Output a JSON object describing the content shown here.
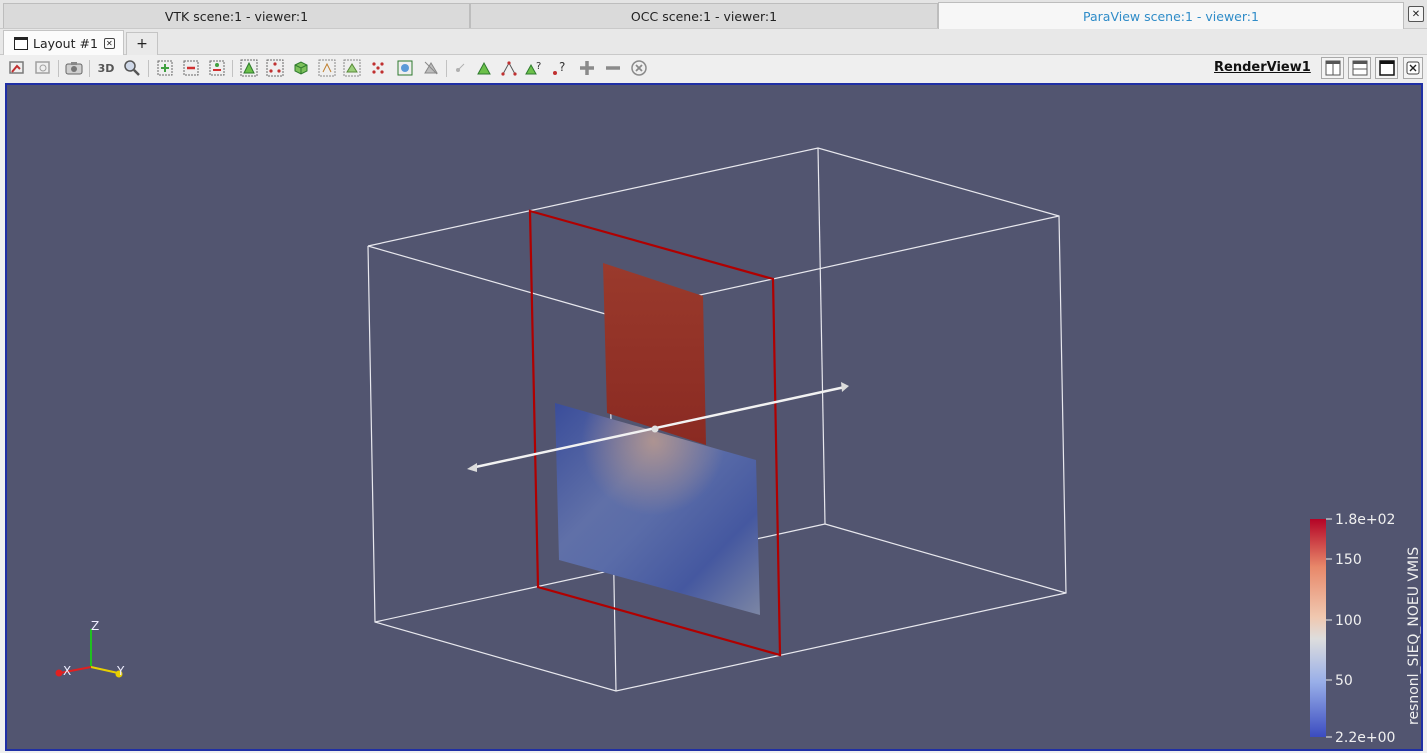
{
  "viewer_tabs": [
    {
      "label": "VTK scene:1 - viewer:1",
      "active": false
    },
    {
      "label": "OCC scene:1 - viewer:1",
      "active": false
    },
    {
      "label": "ParaView scene:1 - viewer:1",
      "active": true
    }
  ],
  "viewer_close_glyph": "✕",
  "layout_tab": {
    "label": "Layout #1",
    "close_glyph": "✕"
  },
  "add_tab_label": "+",
  "toolbar": {
    "three_d_label": "3D",
    "render_view_label": "RenderView1",
    "icons": [
      "reset-camera-closest-icon",
      "reset-camera-icon",
      "capture-screenshot-icon",
      "toggle-3d-icon",
      "zoom-to-box-icon",
      "select-cells-on-icon",
      "select-cells-off-icon",
      "select-points-on-icon",
      "select-cells-frustum-icon",
      "select-points-frustum-icon",
      "select-block-icon",
      "interactive-select-cells-icon",
      "interactive-select-points-icon",
      "select-polygon-cells-icon",
      "hover-points-icon",
      "hover-cells-icon",
      "grow-selection-icon",
      "clear-selection-icon",
      "hover-point-icon",
      "hover-cell-icon",
      "edit-cell-icon",
      "query-icon",
      "query-point-icon",
      "grow-icon",
      "shrink-icon",
      "clear-icon"
    ]
  },
  "scalar_bar": {
    "title": "resnonl_SIEQ_NOEU VMIS",
    "max_label": "1.8e+02",
    "min_label": "2.2e+00",
    "ticks": [
      "150",
      "100",
      "50"
    ],
    "colors": {
      "high": "#b40426",
      "mid": "#dddddd",
      "low": "#3b4cc0"
    }
  },
  "axes": {
    "x": "X",
    "y": "Y",
    "z": "Z",
    "x_color": "#e02020",
    "y_color": "#e8d000",
    "z_color": "#20c020"
  },
  "colors": {
    "background": "#525570",
    "frame_border": "#1f2fa5",
    "accent_tab": "#2f8cc8",
    "plane_outline": "#b00000"
  }
}
